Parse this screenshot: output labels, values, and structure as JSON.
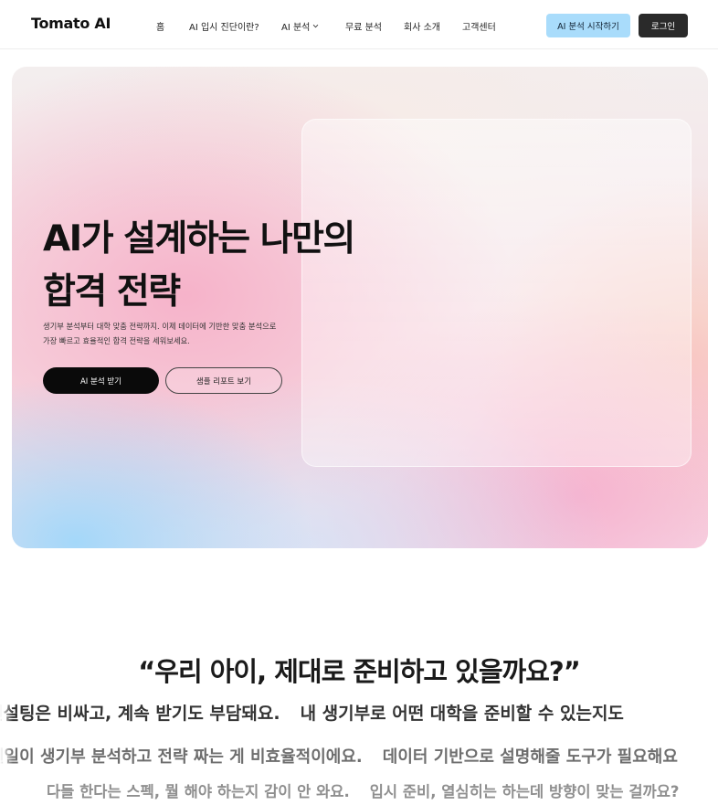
{
  "header": {
    "logo": "Tomato AI",
    "nav": [
      {
        "label": "홈"
      },
      {
        "label": "AI 입시 진단이란?"
      },
      {
        "label": "AI 분석"
      },
      {
        "label": "무료 분석"
      },
      {
        "label": "회사 소개"
      },
      {
        "label": "고객센터"
      }
    ],
    "start_button": "AI 분석 시작하기",
    "login_button": "로그인"
  },
  "hero": {
    "title_line1": "AI가 설계하는 나만의",
    "title_line2": "합격 전략",
    "desc_line1": "생기부 분석부터 대학 맞춤 전략까지. 이제 데이터에 기반한 맞춤 분석으로",
    "desc_line2": "가장 빠르고 효율적인 합격 전략을 세워보세요.",
    "primary_button": "AI 분석 받기",
    "secondary_button": "샘플 리포트 보기"
  },
  "quotes": {
    "title": "“우리 아이, 제대로 준비하고 있을까요?”",
    "row1": [
      "컨설팅은 비싸고, 계속 받기도 부담돼요.",
      "내 생기부로 어떤 대학을 준비할 수 있는지도"
    ],
    "row2": [
      "일일이 생기부 분석하고 전략 짜는 게 비효율적이에요.",
      "데이터 기반으로 설명해줄 도구가 필요해요"
    ],
    "row3": [
      "다들 한다는 스펙, 뭘 해야 하는지 감이 안 와요.",
      "입시 준비, 열심히는 하는데 방향이 맞는 걸까요?"
    ]
  }
}
